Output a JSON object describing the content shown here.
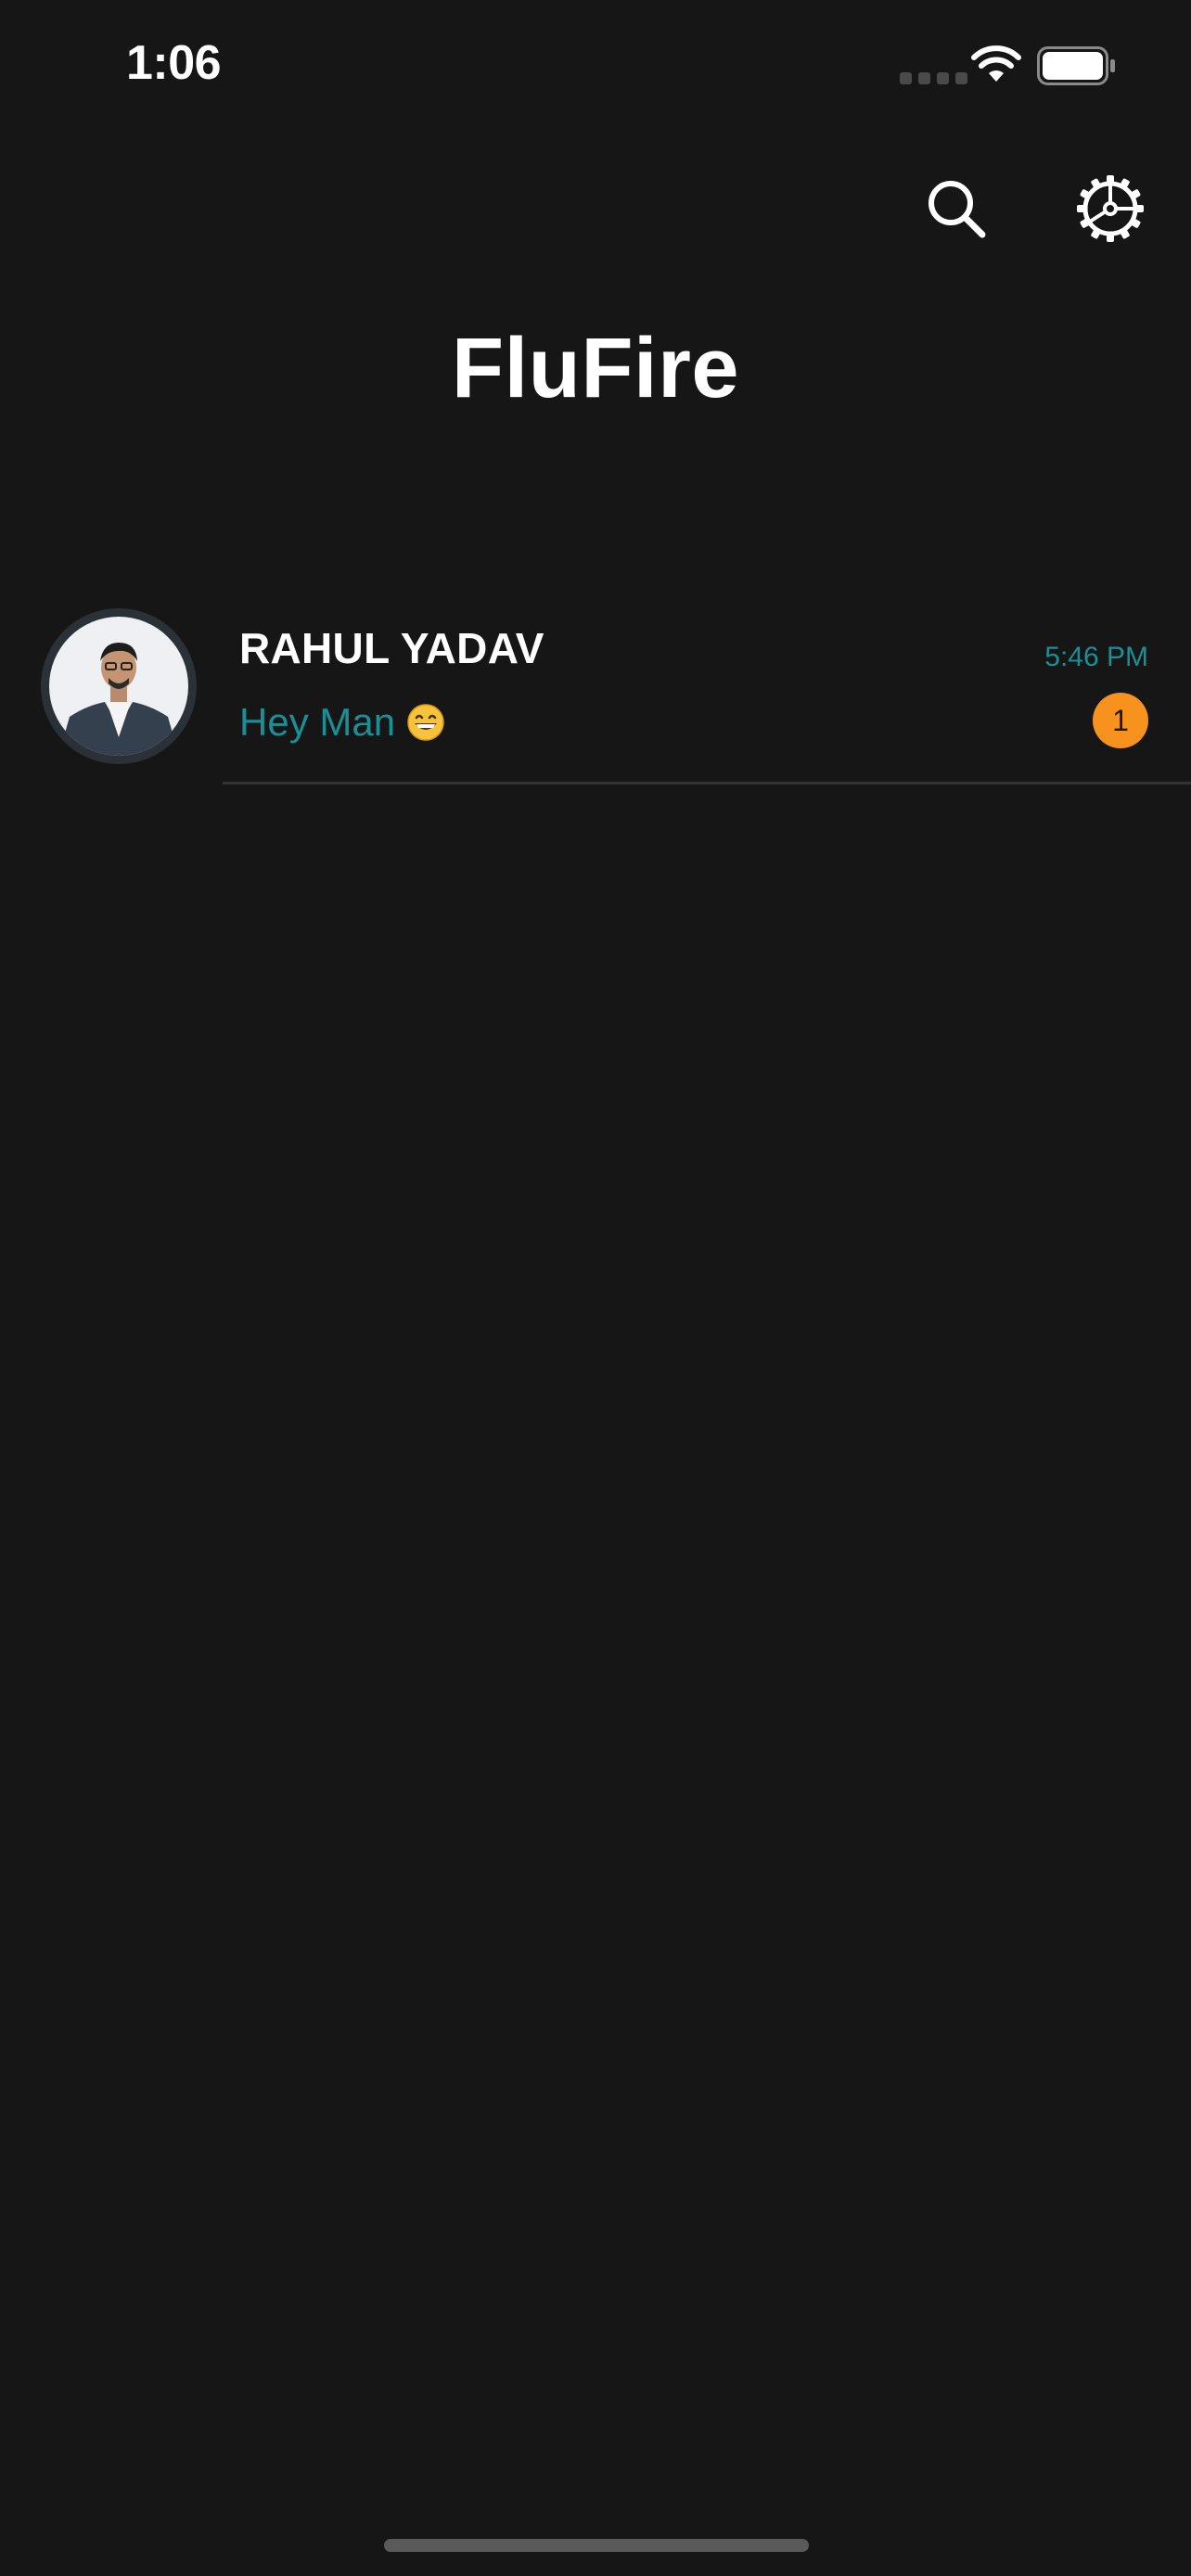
{
  "status_bar": {
    "time": "1:06",
    "icons": [
      "signal-dots-icon",
      "wifi-icon",
      "battery-icon"
    ]
  },
  "header": {
    "title": "FluFire",
    "actions": [
      "search-icon",
      "settings-icon"
    ]
  },
  "chats": [
    {
      "name": "RAHUL YADAV",
      "last_message": "Hey Man",
      "emoji": "grinning-face-icon",
      "time": "5:46 PM",
      "unread_count": "1"
    }
  ],
  "colors": {
    "background": "#161616",
    "accent_teal": "#1b8f95",
    "badge_orange": "#f7921e",
    "divider": "#333333"
  }
}
